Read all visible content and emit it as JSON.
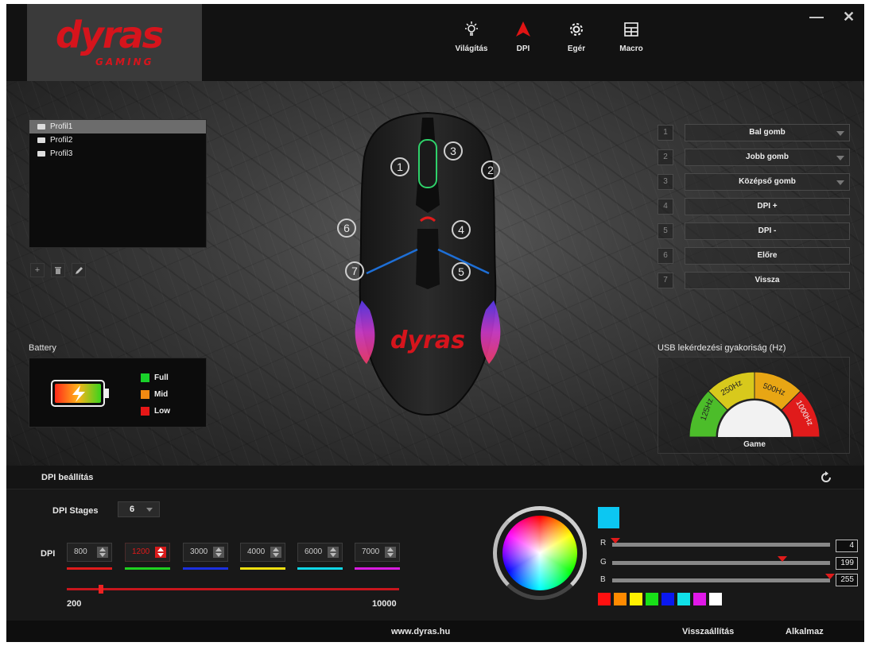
{
  "brand": {
    "name": "dyras",
    "sub": "GAMING",
    "color": "#d6141c"
  },
  "nav": [
    {
      "label": "Világítás",
      "icon": "light-bulb-icon"
    },
    {
      "label": "DPI",
      "icon": "dpi-arrow-icon",
      "active": true
    },
    {
      "label": "Egér",
      "icon": "gear-icon"
    },
    {
      "label": "Macro",
      "icon": "macro-grid-icon"
    }
  ],
  "window": {
    "minimize": "—",
    "close": "✕"
  },
  "profiles": [
    "Profil1",
    "Profil2",
    "Profil3"
  ],
  "profile_tools": {
    "add": "+",
    "delete": "🗑",
    "edit": "✎"
  },
  "battery": {
    "title": "Battery",
    "legend": [
      {
        "label": "Full",
        "color": "#19d12a"
      },
      {
        "label": "Mid",
        "color": "#f28a12"
      },
      {
        "label": "Low",
        "color": "#e61717"
      }
    ]
  },
  "mouse": {
    "logo": "dyras",
    "button_numbers": [
      "1",
      "2",
      "3",
      "4",
      "5",
      "6",
      "7"
    ]
  },
  "buttons": [
    {
      "idx": "1",
      "label": "Bal gomb",
      "dropdown": true
    },
    {
      "idx": "2",
      "label": "Jobb gomb",
      "dropdown": true
    },
    {
      "idx": "3",
      "label": "Középső gomb",
      "dropdown": true
    },
    {
      "idx": "4",
      "label": "DPI +",
      "dropdown": false
    },
    {
      "idx": "5",
      "label": "DPI -",
      "dropdown": false
    },
    {
      "idx": "6",
      "label": "Előre",
      "dropdown": false
    },
    {
      "idx": "7",
      "label": "Vissza",
      "dropdown": false
    }
  ],
  "usb": {
    "title": "USB lekérdezési gyakoriság (Hz)",
    "rates": [
      "125Hz",
      "250Hz",
      "500Hz",
      "1000Hz"
    ],
    "mode": "Game"
  },
  "dpi": {
    "section_title": "DPI beállítás",
    "stages_label": "DPI Stages",
    "stages_value": "6",
    "dpi_label": "DPI",
    "values": [
      {
        "value": "800",
        "color": "#e01b1b"
      },
      {
        "value": "1200",
        "color": "#1fd11f",
        "active": true
      },
      {
        "value": "3000",
        "color": "#1b2fe0"
      },
      {
        "value": "4000",
        "color": "#f0e010"
      },
      {
        "value": "6000",
        "color": "#10d8e8"
      },
      {
        "value": "7000",
        "color": "#d81ce0"
      }
    ],
    "range_min": "200",
    "range_max": "10000",
    "slider_value": 1200
  },
  "color": {
    "preview": "#0cc7f2",
    "channels": [
      {
        "name": "R",
        "value": "4"
      },
      {
        "name": "G",
        "value": "199"
      },
      {
        "name": "B",
        "value": "255"
      }
    ],
    "presets": [
      "#ff1010",
      "#ff8a00",
      "#fff000",
      "#18e018",
      "#0a18f0",
      "#10e0e8",
      "#e018e8",
      "#ffffff"
    ]
  },
  "footer": {
    "site": "www.dyras.hu",
    "restore": "Visszaállítás",
    "apply": "Alkalmaz"
  }
}
